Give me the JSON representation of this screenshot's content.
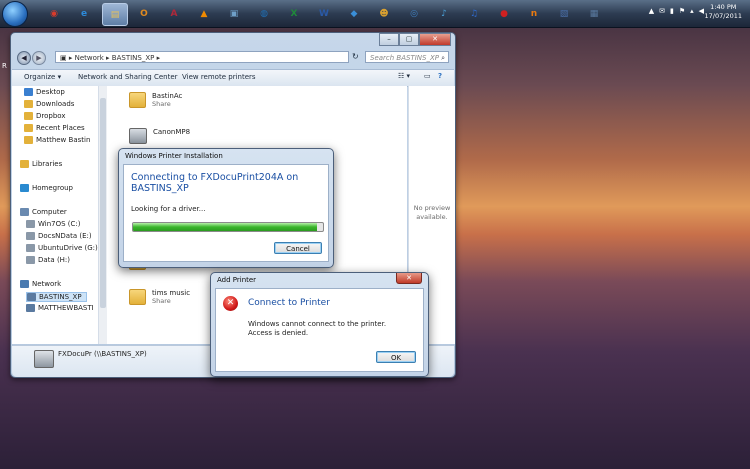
{
  "taskbar": {
    "apps": [
      {
        "name": "chrome",
        "glyph": "◉",
        "color": "#d93b2b"
      },
      {
        "name": "internet-explorer",
        "glyph": "e",
        "color": "#2d8ad9"
      },
      {
        "name": "windows-explorer",
        "glyph": "▤",
        "color": "#e8c25a"
      },
      {
        "name": "outlook",
        "glyph": "O",
        "color": "#e08a1f"
      },
      {
        "name": "access",
        "glyph": "A",
        "color": "#b0283a"
      },
      {
        "name": "vlc",
        "glyph": "▲",
        "color": "#f08a00"
      },
      {
        "name": "image-viewer",
        "glyph": "▣",
        "color": "#6fa0c8"
      },
      {
        "name": "globe",
        "glyph": "◍",
        "color": "#1f6fb5"
      },
      {
        "name": "excel",
        "glyph": "X",
        "color": "#1f8a3a"
      },
      {
        "name": "word",
        "glyph": "W",
        "color": "#2a5aa8"
      },
      {
        "name": "dropbox",
        "glyph": "◆",
        "color": "#3a8fd8"
      },
      {
        "name": "person",
        "glyph": "☻",
        "color": "#d8a030"
      },
      {
        "name": "network",
        "glyph": "◎",
        "color": "#3f7fbf"
      },
      {
        "name": "media-player",
        "glyph": "♪",
        "color": "#4aa0d8"
      },
      {
        "name": "itunes",
        "glyph": "♫",
        "color": "#2f6ad0"
      },
      {
        "name": "record",
        "glyph": "●",
        "color": "#d02020"
      },
      {
        "name": "n-app",
        "glyph": "n",
        "color": "#e87a10"
      },
      {
        "name": "virtualbox",
        "glyph": "▧",
        "color": "#4a6fa8"
      },
      {
        "name": "remote",
        "glyph": "▦",
        "color": "#5a7aa0"
      }
    ],
    "tray_icons": [
      "▲",
      "✉",
      "▮",
      "⚑",
      "▴",
      "◀"
    ],
    "clock_time": "1:40 PM",
    "clock_date": "17/07/2011"
  },
  "desktop": {
    "edge_label": "R"
  },
  "explorer": {
    "address_parts": [
      "Network",
      "BASTINS_XP"
    ],
    "address_sep": "▸",
    "search_placeholder": "Search BASTINS_XP",
    "toolbar": {
      "organize": "Organize",
      "network_center": "Network and Sharing Center",
      "remote_printers": "View remote printers"
    },
    "nav": [
      {
        "label": "Desktop",
        "kind": "desktop"
      },
      {
        "label": "Downloads",
        "kind": "folder"
      },
      {
        "label": "Dropbox",
        "kind": "folder"
      },
      {
        "label": "Recent Places",
        "kind": "folder"
      },
      {
        "label": "Matthew Bastin",
        "kind": "folder"
      },
      {
        "label": "Libraries",
        "kind": "library"
      },
      {
        "label": "Homegroup",
        "kind": "homegroup"
      },
      {
        "label": "Computer",
        "kind": "computer"
      },
      {
        "label": "Win7OS (C:)",
        "kind": "drive"
      },
      {
        "label": "DocsNData (E:)",
        "kind": "drive"
      },
      {
        "label": "UbuntuDrive (G:)",
        "kind": "drive"
      },
      {
        "label": "Data (H:)",
        "kind": "drive"
      },
      {
        "label": "Network",
        "kind": "network"
      },
      {
        "label": "BASTINS_XP",
        "kind": "pc"
      },
      {
        "label": "MATTHEWBASTI",
        "kind": "pc"
      }
    ],
    "items": [
      {
        "name": "BastinAc",
        "sub": "Share",
        "kind": "folder"
      },
      {
        "name": "CanonMP8",
        "sub": "",
        "kind": "printer"
      },
      {
        "name": "...",
        "sub": "",
        "kind": "folder"
      },
      {
        "name": "tims music",
        "sub": "Share",
        "kind": "folder"
      }
    ],
    "preview_text": "No preview available.",
    "details_label": "FXDocuPr (\\\\BASTINS_XP)"
  },
  "printer_install": {
    "title": "Windows Printer Installation",
    "heading": "Connecting to FXDocuPrint204A on BASTINS_XP",
    "status": "Looking for a driver...",
    "progress_fraction": 0.97,
    "cancel_label": "Cancel"
  },
  "add_printer": {
    "title": "Add Printer",
    "close_label": "✕",
    "heading": "Connect to Printer",
    "message": "Windows cannot connect to the printer.  Access is denied.",
    "ok_label": "OK"
  }
}
